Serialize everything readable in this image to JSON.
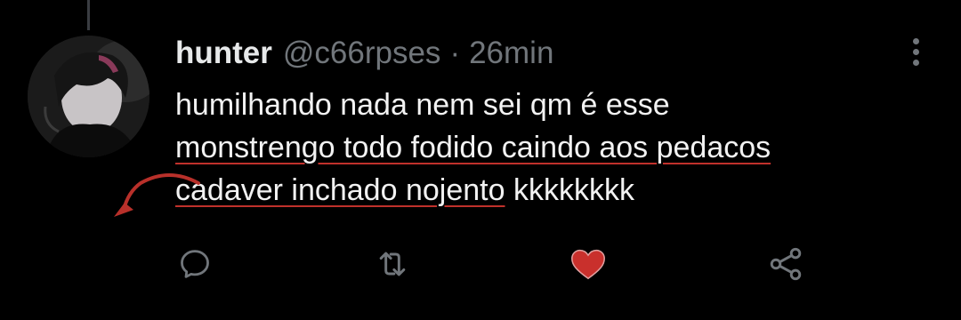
{
  "tweet": {
    "author": {
      "display_name": "hunter",
      "handle": "@c66rpses"
    },
    "separator": "·",
    "time": "26min",
    "text_lines": [
      "humilhando nada nem sei qm é esse",
      "monstrengo todo fodido caindo aos pedacos",
      "cadaver inchado nojento",
      " kkkkkkkk"
    ]
  },
  "icons": {
    "more": "more-vertical-icon",
    "reply": "reply-icon",
    "retweet": "retweet-icon",
    "like": "heart-icon",
    "share": "share-icon",
    "annotation": "curved-arrow-icon"
  },
  "colors": {
    "background": "#000000",
    "text": "#e7e9ea",
    "secondary": "#71767b",
    "like_active": "#c9302c",
    "annotation": "#c0312b"
  },
  "state": {
    "liked": true
  }
}
